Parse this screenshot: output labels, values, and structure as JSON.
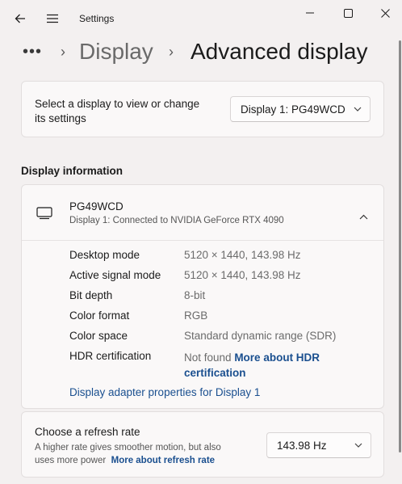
{
  "window": {
    "app_title": "Settings"
  },
  "breadcrumb": {
    "ellipsis": "•••",
    "separator": "›",
    "parent": "Display",
    "current": "Advanced display"
  },
  "select_display": {
    "label_line1": "Select a display to view or change",
    "label_line2": "its settings",
    "selected": "Display 1: PG49WCD"
  },
  "display_information": {
    "section_title": "Display information",
    "monitor_name": "PG49WCD",
    "monitor_subtitle": "Display 1: Connected to NVIDIA GeForce RTX 4090",
    "rows": [
      {
        "label": "Desktop mode",
        "value": "5120 × 1440, 143.98 Hz"
      },
      {
        "label": "Active signal mode",
        "value": "5120 × 1440, 143.98 Hz"
      },
      {
        "label": "Bit depth",
        "value": "8-bit"
      },
      {
        "label": "Color format",
        "value": "RGB"
      },
      {
        "label": "Color space",
        "value": "Standard dynamic range (SDR)"
      }
    ],
    "hdr_label": "HDR certification",
    "hdr_value": "Not found",
    "hdr_link_line1": "More about HDR",
    "hdr_link_line2": "certification",
    "adapter_link": "Display adapter properties for Display 1"
  },
  "refresh_rate": {
    "title": "Choose a refresh rate",
    "desc_line1": "A higher rate gives smoother motion, but also",
    "desc_line2": "uses more power",
    "more_link": "More about refresh rate",
    "selected": "143.98 Hz"
  },
  "icons": {
    "back": "back-arrow-icon",
    "menu": "hamburger-menu-icon",
    "minimize": "minimize-icon",
    "maximize": "maximize-icon",
    "close": "close-icon",
    "monitor": "monitor-icon",
    "chevron_down": "chevron-down-icon",
    "chevron_up": "chevron-up-icon"
  }
}
